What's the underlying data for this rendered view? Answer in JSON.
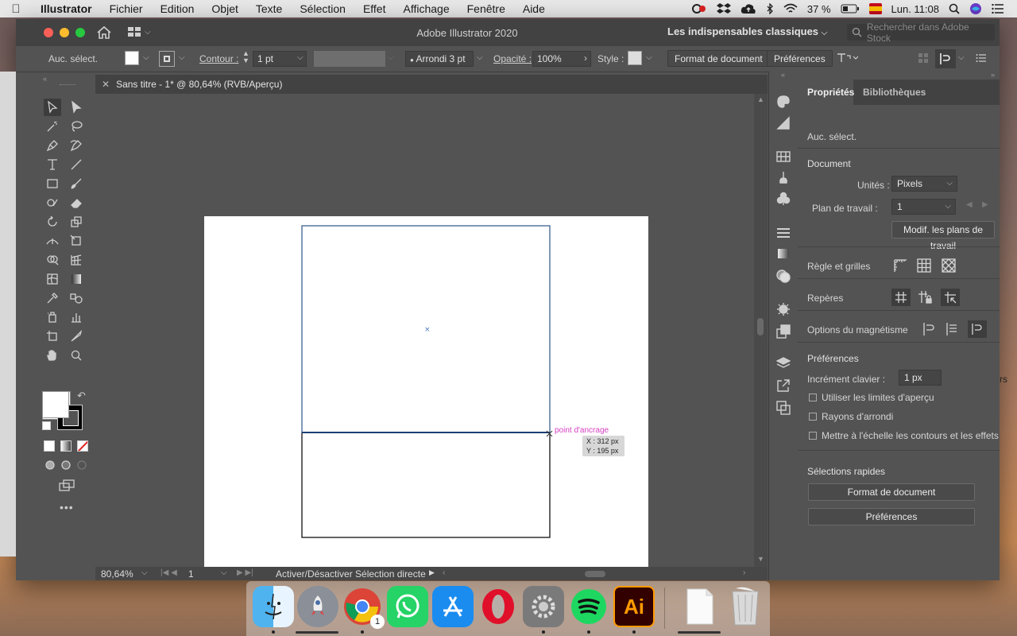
{
  "menubar": {
    "app": "Illustrator",
    "items": [
      "Fichier",
      "Edition",
      "Objet",
      "Texte",
      "Sélection",
      "Effet",
      "Affichage",
      "Fenêtre",
      "Aide"
    ],
    "battery": "37 %",
    "clock": "Lun. 11:08"
  },
  "window": {
    "title": "Adobe Illustrator 2020",
    "workspace": "Les indispensables classiques",
    "search_placeholder": "Rechercher dans Adobe Stock"
  },
  "controlbar": {
    "selection": "Auc. sélect.",
    "stroke_label": "Contour :",
    "stroke_value": "1 pt",
    "brush": "Arrondi 3 pt",
    "opacity_label": "Opacité :",
    "opacity_value": "100%",
    "style_label": "Style :",
    "doc_setup": "Format de document",
    "prefs": "Préférences"
  },
  "document": {
    "tab": "Sans titre - 1* @ 80,64% (RVB/Aperçu)",
    "tooltip_label": "point d'ancrage",
    "coord_x": "X : 312 px",
    "coord_y": "Y : 195 px"
  },
  "statusbar": {
    "zoom": "80,64%",
    "artboard": "1",
    "tool_hint": "Activer/Désactiver Sélection directe"
  },
  "properties": {
    "tab_properties": "Propriétés",
    "tab_libraries": "Bibliothèques",
    "no_selection": "Auc. sélect.",
    "document_title": "Document",
    "units_label": "Unités :",
    "units_value": "Pixels",
    "artboard_label": "Plan de travail :",
    "artboard_value": "1",
    "edit_artboards": "Modif. les plans de travail",
    "rulers_grids": "Règle et grilles",
    "guides": "Repères",
    "snap_options": "Options du magnétisme",
    "preferences_title": "Préférences",
    "keyboard_increment_label": "Incrément clavier :",
    "keyboard_increment_value": "1 px",
    "use_preview_bounds": "Utiliser les limites d'aperçu",
    "rounded_corners": "Rayons d'arrondi",
    "scale_strokes": "Mettre à l'échelle les contours et les effets",
    "quick_actions": "Sélections rapides",
    "btn_doc_setup": "Format de document",
    "btn_prefs": "Préférences"
  },
  "colors": {
    "ui_dark": "#535353",
    "accent_pink": "#d63fc3",
    "selection_blue": "#2a5b9e"
  }
}
